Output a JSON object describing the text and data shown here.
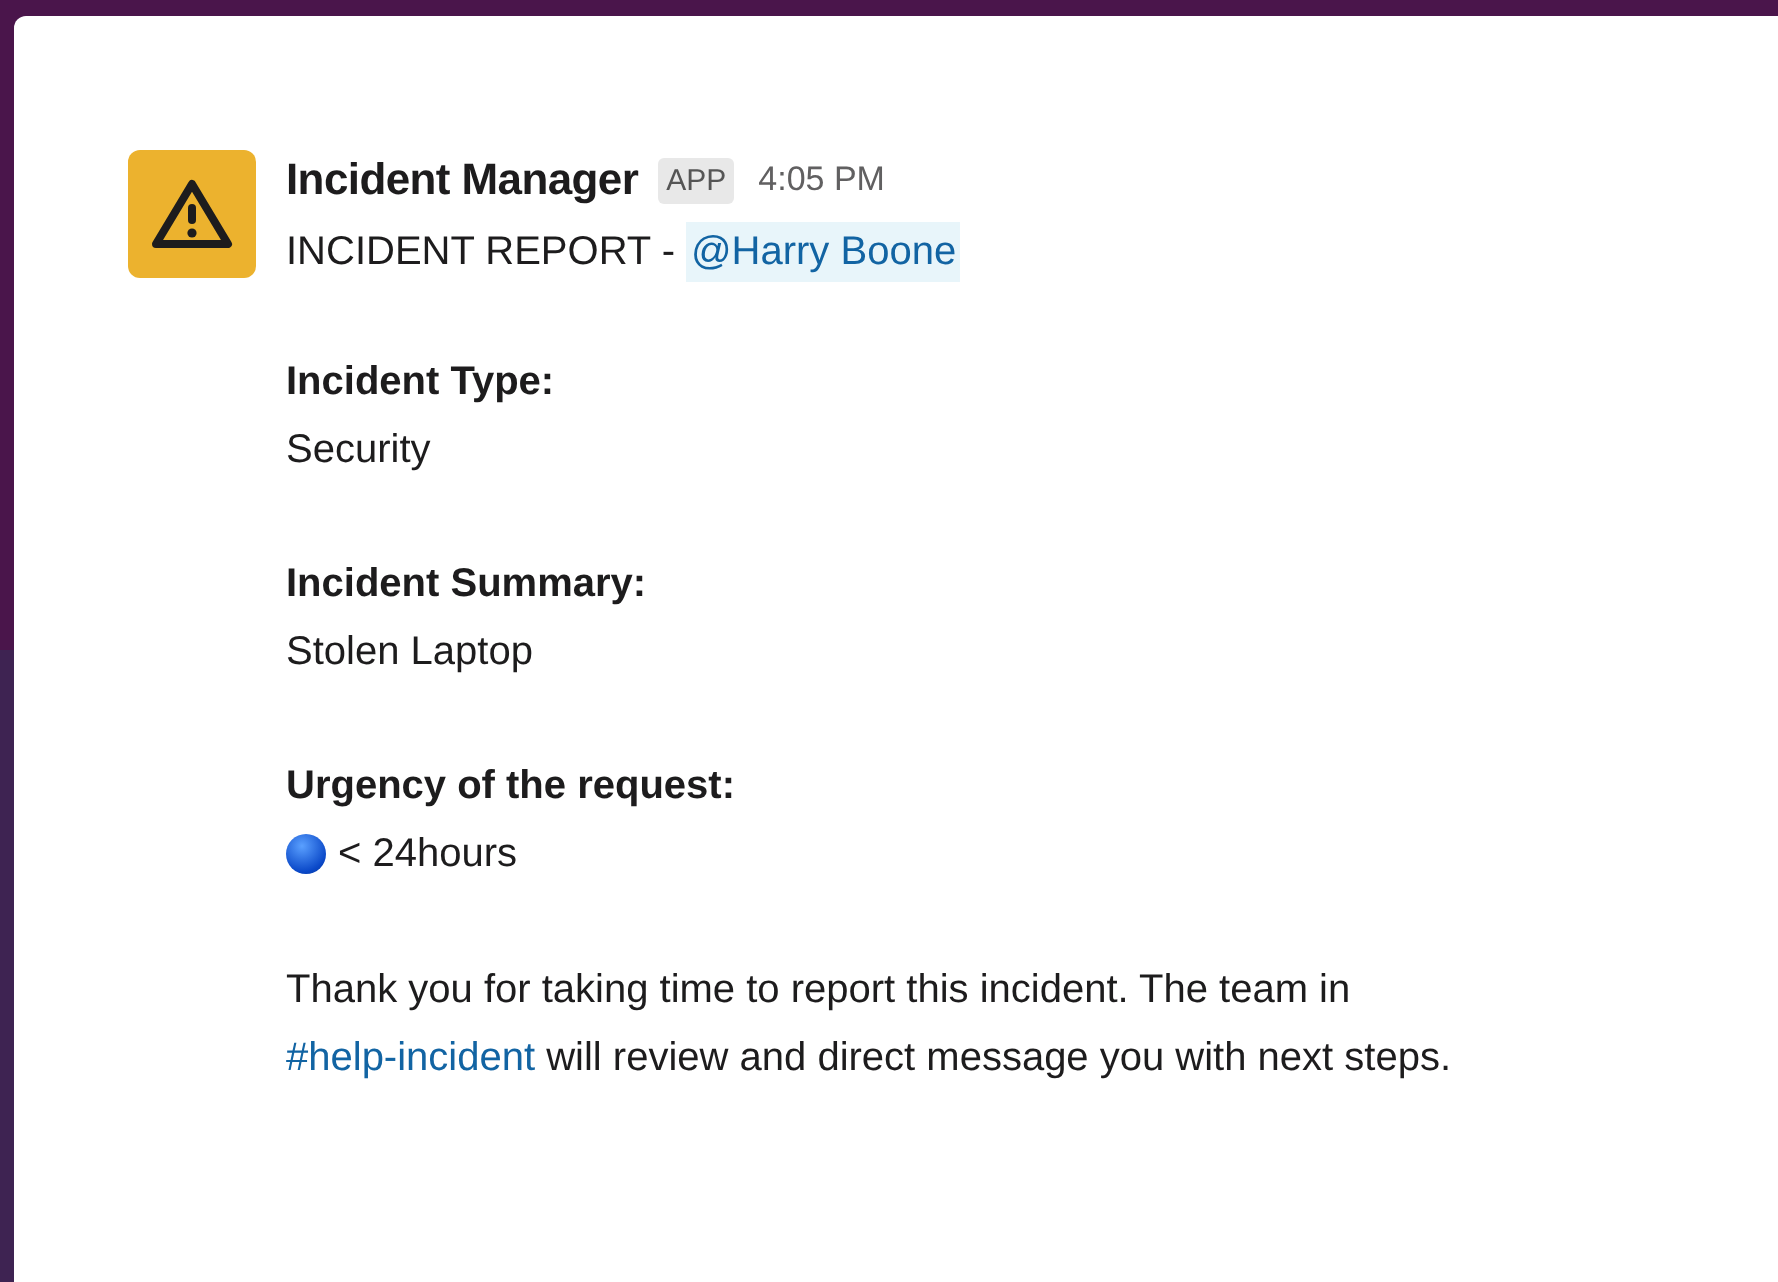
{
  "message": {
    "sender": "Incident Manager",
    "badge": "APP",
    "time": "4:05 PM",
    "title": "INCIDENT REPORT -",
    "mention": "@Harry Boone",
    "fields": [
      {
        "label": "Incident Type:",
        "value": "Security",
        "kind": "plain"
      },
      {
        "label": "Incident Summary:",
        "value": "Stolen Laptop",
        "kind": "plain"
      },
      {
        "label": "Urgency of the request:",
        "value": "< 24hours",
        "kind": "dot"
      }
    ],
    "closing": {
      "before": "Thank you for taking time to report this incident. The team in",
      "link": "#help-incident",
      "after": "will review and direct message you with next steps."
    }
  }
}
